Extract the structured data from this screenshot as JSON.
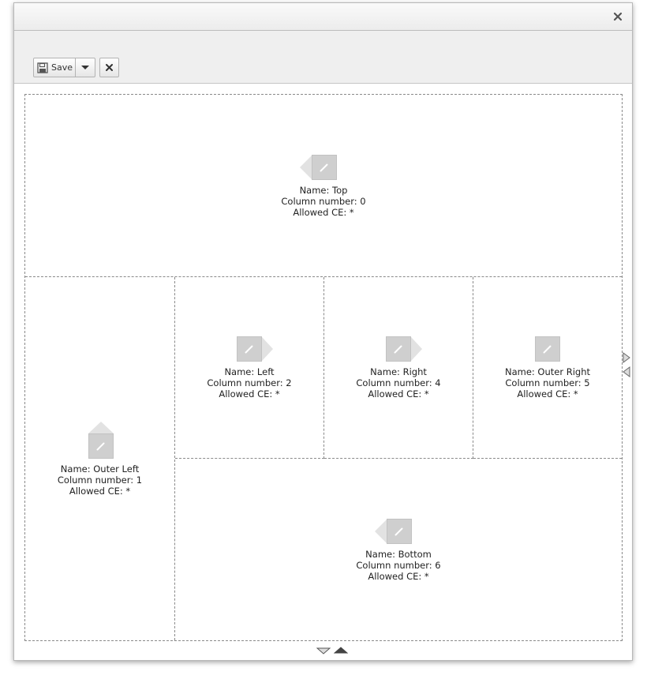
{
  "toolbar": {
    "save_label": "Save"
  },
  "cells": {
    "top": {
      "name": "Name: Top",
      "column": "Column number: 0",
      "allowed": "Allowed CE: *"
    },
    "outer_left": {
      "name": "Name: Outer Left",
      "column": "Column number: 1",
      "allowed": "Allowed CE: *"
    },
    "left": {
      "name": "Name: Left",
      "column": "Column number: 2",
      "allowed": "Allowed CE: *"
    },
    "right": {
      "name": "Name: Right",
      "column": "Column number: 4",
      "allowed": "Allowed CE: *"
    },
    "outer_right": {
      "name": "Name: Outer Right",
      "column": "Column number: 5",
      "allowed": "Allowed CE: *"
    },
    "bottom": {
      "name": "Name: Bottom",
      "column": "Column number: 6",
      "allowed": "Allowed CE: *"
    }
  },
  "icons": {
    "close": "close-icon",
    "save": "floppy-disk-icon",
    "dropdown": "caret-down-icon",
    "edit": "pencil-icon",
    "add_column_left": "arrow-left-icon",
    "add_column_right": "arrow-right-icon",
    "remove_row": "arrow-up-icon",
    "add_row": "arrow-down-icon"
  },
  "colors": {
    "toolbar_bg": "#efefef",
    "edit_icon_bg": "#cfcfcf",
    "arrow_gray": "#e2e2e2",
    "dashed_border": "#8a8a8a"
  }
}
